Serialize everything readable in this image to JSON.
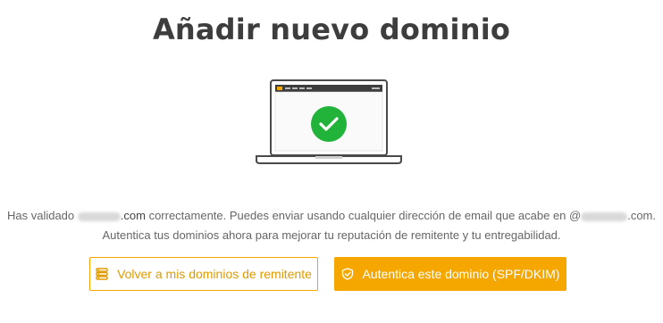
{
  "page": {
    "title": "Añadir nuevo dominio"
  },
  "message": {
    "line1_a": "Has validado",
    "line1_domain_tld": ".com",
    "line1_b": "correctamente. Puedes enviar usando cualquier dirección de email que acabe en @",
    "line1_c": ".com.",
    "line2": "Autentica tus dominios ahora para mejorar tu reputación de remitente y tu entregabilidad."
  },
  "buttons": {
    "back_label": "Volver a mis dominios de remitente",
    "auth_label": "Autentica este dominio (SPF/DKIM)"
  },
  "icons": {
    "back": "server-list-icon",
    "auth": "shield-check-icon",
    "success": "check-icon"
  },
  "colors": {
    "accent": "#f5a700",
    "success": "#22b33a",
    "title": "#3d3d3d"
  }
}
